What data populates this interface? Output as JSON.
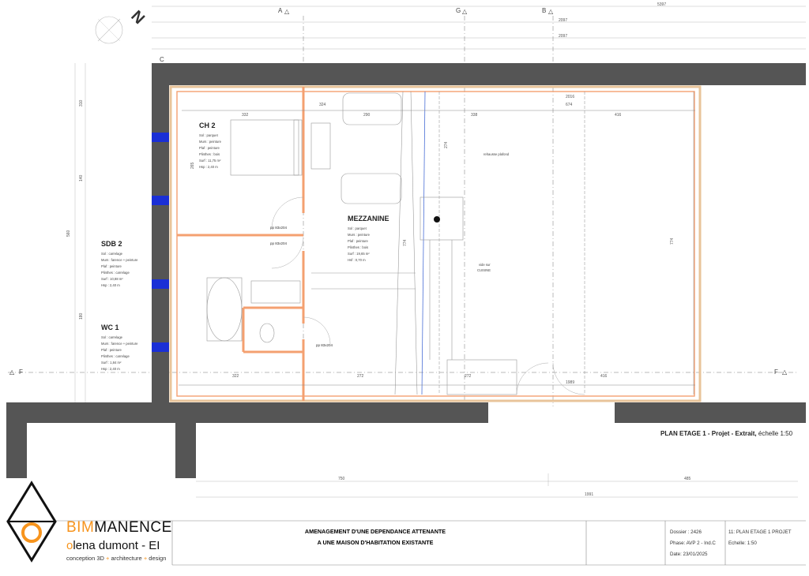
{
  "grid": {
    "axis_a": "A",
    "axis_g": "G",
    "axis_b": "B",
    "axis_c": "C",
    "section_f_left": "F",
    "section_f_right": "F",
    "north": "N"
  },
  "rooms": {
    "ch2": {
      "name": "CH 2",
      "specs": [
        "Sol : parquet",
        "Murs : peinture",
        "Plaf : peinture",
        "Plinthes : bois",
        "Surf : 11,75 m²",
        "Hsp : 2,40 m"
      ]
    },
    "mezzanine": {
      "name": "MEZZANINE",
      "specs": [
        "Sol : parquet",
        "Murs : peinture",
        "Plaf : peinture",
        "Plinthes : bois",
        "Surf : 19,65 m²",
        "Hsf : 0,70 m"
      ]
    },
    "sdb2": {
      "name": "SDB 2",
      "specs": [
        "Sol : carrelage",
        "Murs : faïence + peinture",
        "Plaf : peinture",
        "Plinthes : carrelage",
        "Surf : 10,88 m²",
        "Hsp : 2,40 m"
      ]
    },
    "wc1": {
      "name": "WC 1",
      "specs": [
        "Sol : carrelage",
        "Murs : faïence + peinture",
        "Plaf : peinture",
        "Plinthes : carrelage",
        "Surf : 1,84 m²",
        "Hsp : 2,40 m"
      ]
    }
  },
  "annotations": {
    "raised_ceiling": "rehausse plafond",
    "void_kitchen_1": "vide sur",
    "void_kitchen_2": "CUISINE",
    "door_1": "pp 83x204",
    "door_2": "pp 83x204",
    "door_3": "pp 83x204"
  },
  "dimensions": {
    "top_total": "5397",
    "top_2": "2097",
    "top_3": "2097",
    "ch2_width": "332",
    "c324": "324",
    "c290": "290",
    "c338": "338",
    "c416": "416",
    "c2016": "2016",
    "c674": "674",
    "bottom_322": "322",
    "bottom_272": "272",
    "bottom_272b": "272",
    "bottom_416": "416",
    "bottom_1989": "1989",
    "bottom_750": "750",
    "bottom_485": "485",
    "bottom_1991": "1991",
    "left_560": "560",
    "left_310": "310",
    "left_180": "180",
    "left_140": "140",
    "h774": "774",
    "h774b": "774",
    "h274": "274",
    "h265": "265"
  },
  "caption": {
    "bold_part": "PLAN ETAGE 1 - Projet - Extrait,",
    "scale_part": " échelle 1:50"
  },
  "title_block": {
    "brand_main": "BIM",
    "brand_rest": "MANENCE",
    "designer_initial": "o",
    "designer_rest": "lena dumont - EI",
    "tagline_1": "conception 3D",
    "tagline_2": "architecture",
    "tagline_3": "design",
    "tagline_sep": "+",
    "project_line_1": "AMENAGEMENT D'UNE DEPENDANCE ATTENANTE",
    "project_line_2": "A UNE MAISON D'HABITATION EXISTANTE",
    "dossier": "Dossier : 2426",
    "phase": "Phase: AVP 2 - Ind.C",
    "date": "Date: 23/01/2025",
    "sheet": "11: PLAN ETAGE 1 PROJET",
    "scale": "Echelle: 1:50"
  },
  "colors": {
    "wall": "#555555",
    "partition": "#f4a070",
    "window": "#1a2fd6",
    "accent": "#f7941d",
    "door_text": "#3aa53a"
  }
}
